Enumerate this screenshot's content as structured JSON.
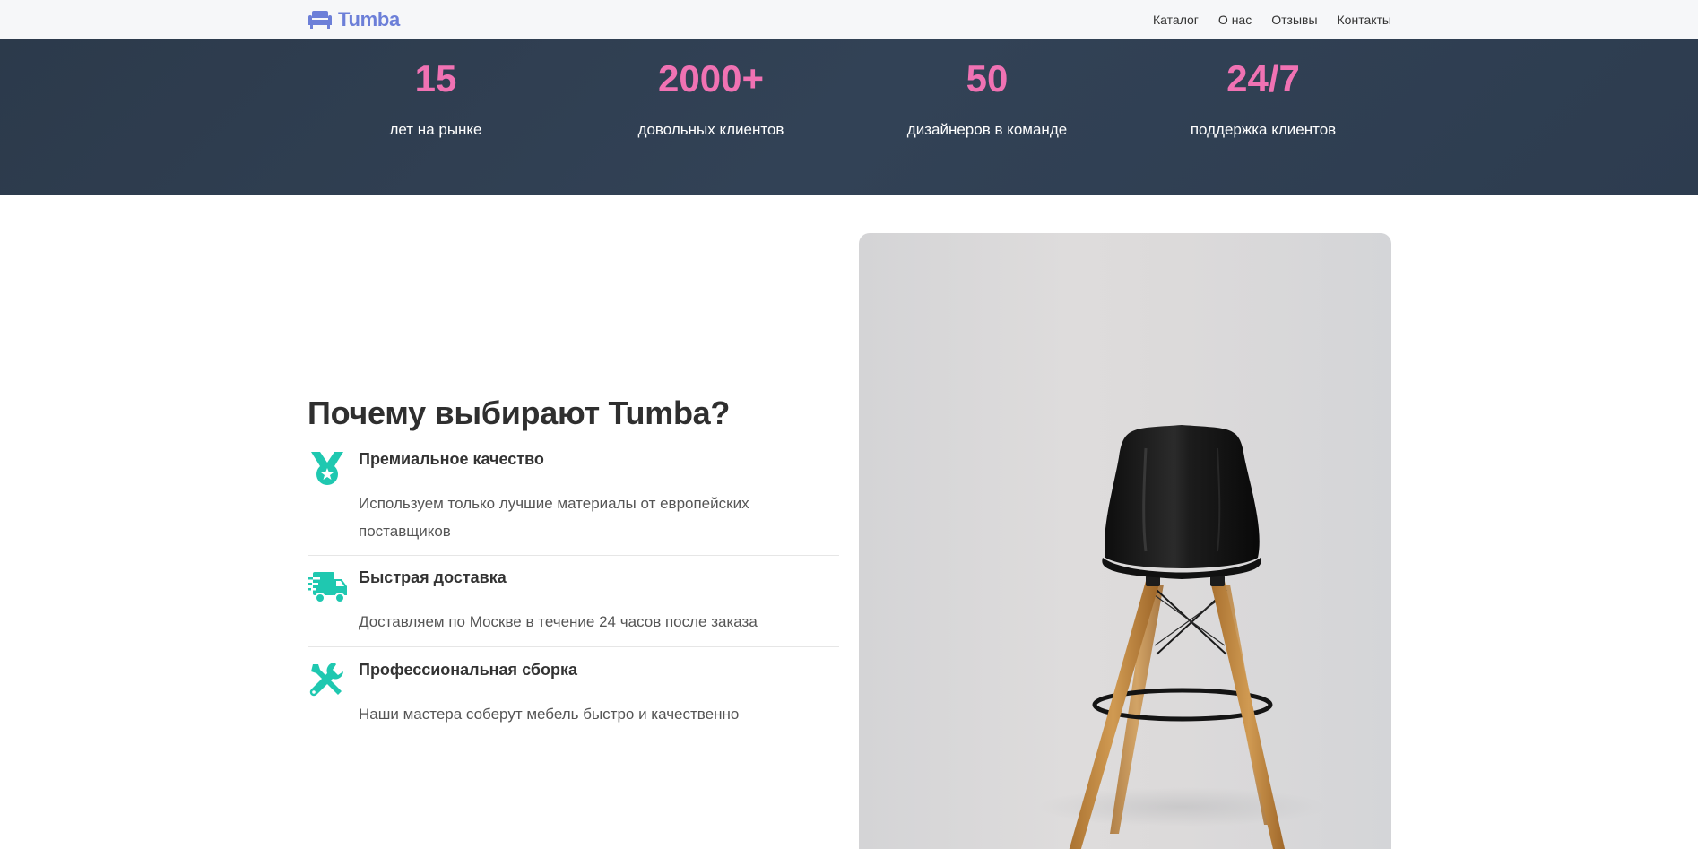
{
  "brand": {
    "name": "Tumba",
    "icon": "sofa-icon",
    "color": "#6c7fd8"
  },
  "nav": {
    "items": [
      "Каталог",
      "О нас",
      "Отзывы",
      "Контакты"
    ]
  },
  "stats": [
    {
      "value": "15",
      "label": "лет на рынке"
    },
    {
      "value": "2000+",
      "label": "довольных клиентов"
    },
    {
      "value": "50",
      "label": "дизайнеров в команде"
    },
    {
      "value": "24/7",
      "label": "поддержка клиентов"
    }
  ],
  "why": {
    "title": "Почему выбирают Tumba?",
    "features": [
      {
        "icon": "medal-icon",
        "title": "Премиальное качество",
        "description": "Используем только лучшие материалы от европейских поставщиков"
      },
      {
        "icon": "truck-icon",
        "title": "Быстрая доставка",
        "description": "Доставляем по Москве в течение 24 часов после заказа"
      },
      {
        "icon": "tools-icon",
        "title": "Профессиональная сборка",
        "description": "Наши мастера соберут мебель быстро и качественно"
      }
    ]
  },
  "image": {
    "subject": "chair-photo"
  },
  "colors": {
    "accent": "#f072b3",
    "icon": "#1fc8b0",
    "band": "#2f3e50"
  }
}
